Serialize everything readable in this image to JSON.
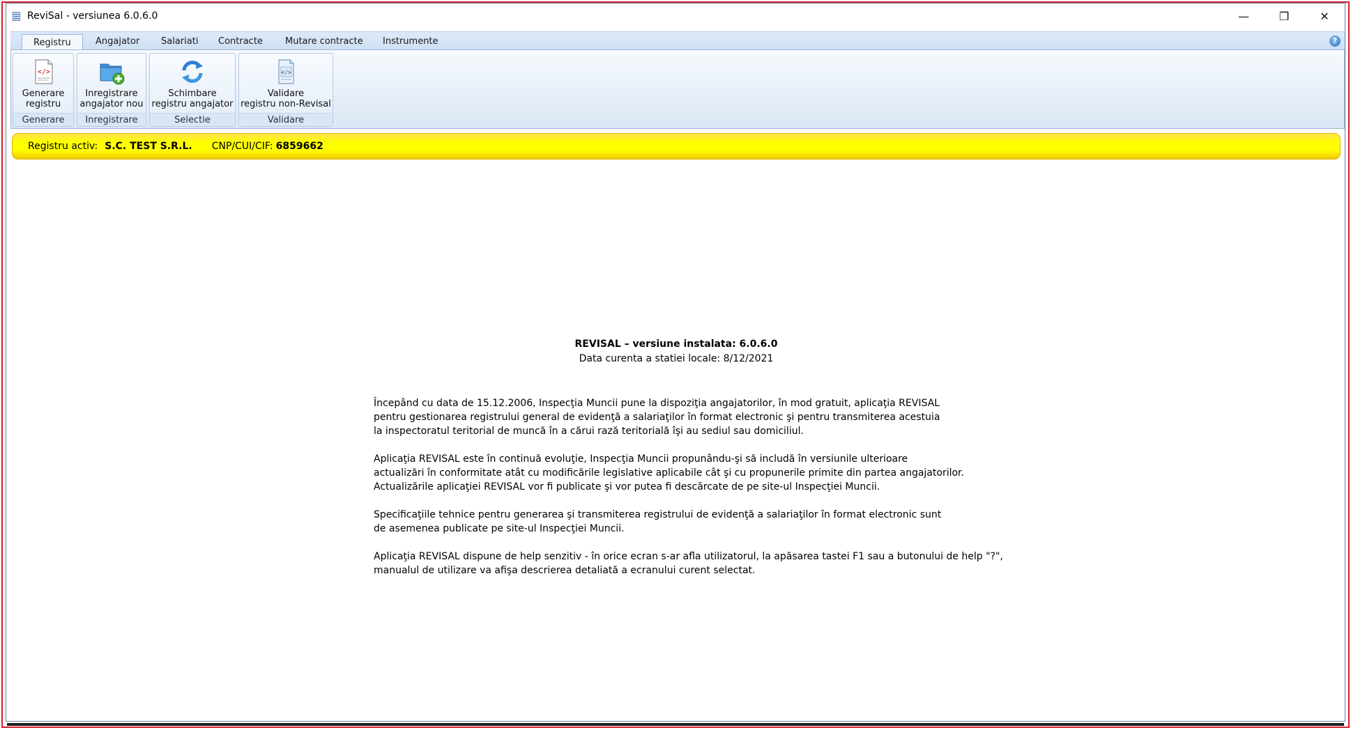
{
  "window": {
    "title": "ReviSal - versiunea 6.0.6.0",
    "minimize_glyph": "—",
    "restore_glyph": "❐",
    "close_glyph": "✕"
  },
  "tabs": [
    {
      "label": "Registru",
      "active": true
    },
    {
      "label": "Angajator"
    },
    {
      "label": "Salariati"
    },
    {
      "label": "Contracte"
    },
    {
      "label": "Mutare contracte"
    },
    {
      "label": "Instrumente"
    }
  ],
  "help_glyph": "?",
  "ribbon_groups": [
    {
      "button_line1": "Generare",
      "button_line2": "registru",
      "caption": "Generare",
      "icon": "xml-document-icon"
    },
    {
      "button_line1": "Inregistrare",
      "button_line2": "angajator nou",
      "caption": "Inregistrare",
      "icon": "folder-add-icon"
    },
    {
      "button_line1": "Schimbare",
      "button_line2": "registru angajator",
      "caption": "Selectie",
      "icon": "refresh-icon"
    },
    {
      "button_line1": "Validare",
      "button_line2": "registru non-Revisal",
      "caption": "Validare",
      "icon": "validate-document-icon"
    }
  ],
  "status": {
    "label": "Registru activ:",
    "company": "S.C. TEST S.R.L.",
    "cif_label": "CNP/CUI/CIF:",
    "cif_value": "6859662"
  },
  "main": {
    "version_title": "REVISAL – versiune instalata: 6.0.6.0",
    "date_line": "Data curenta a statiei locale: 8/12/2021",
    "paragraphs": [
      [
        "Începând cu data de 15.12.2006, Inspecţia Muncii pune la dispoziţia angajatorilor, în mod gratuit, aplicaţia REVISAL",
        "pentru gestionarea registrului general de evidenţă a salariaţilor în format electronic şi pentru transmiterea acestuia",
        "la inspectoratul teritorial de muncă în a cărui rază teritorială îşi au sediul sau domiciliul."
      ],
      [
        "Aplicaţia REVISAL este în continuă evoluţie, Inspecţia Muncii propunându-şi să includă în versiunile ulterioare",
        "actualizări în conformitate atât cu modificările legislative aplicabile cât şi cu propunerile primite din partea angajatorilor.",
        "Actualizările aplicaţiei REVISAL vor fi publicate şi vor putea fi descărcate de pe site-ul Inspecţiei Muncii."
      ],
      [
        "Specificaţiile tehnice pentru generarea şi transmiterea registrului de evidenţă a salariaţilor în format electronic sunt",
        "de asemenea publicate pe site-ul Inspecţiei Muncii."
      ],
      [
        "Aplicaţia REVISAL dispune de help senzitiv - în orice ecran s-ar afla utilizatorul, la apăsarea tastei F1 sau a butonului de help \"?\",",
        "manualul de utilizare va afişa descrierea detaliată a ecranului curent selectat."
      ]
    ]
  }
}
